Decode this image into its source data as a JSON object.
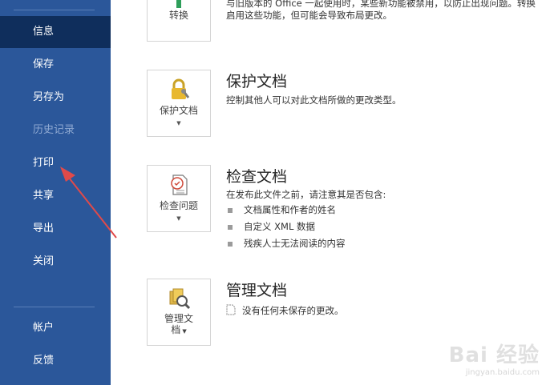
{
  "sidebar": {
    "items": [
      {
        "label": "信息",
        "state": "active"
      },
      {
        "label": "保存",
        "state": "normal"
      },
      {
        "label": "另存为",
        "state": "normal"
      },
      {
        "label": "历史记录",
        "state": "disabled"
      },
      {
        "label": "打印",
        "state": "normal"
      },
      {
        "label": "共享",
        "state": "normal"
      },
      {
        "label": "导出",
        "state": "normal"
      },
      {
        "label": "关闭",
        "state": "normal"
      }
    ],
    "bottom_items": [
      {
        "label": "帐户"
      },
      {
        "label": "反馈"
      }
    ]
  },
  "convert": {
    "button_label": "转换",
    "text_line1": "与旧版本的 Office 一起使用时，某些新功能被禁用，以防止出现问题。转换",
    "text_line2": "启用这些功能，但可能会导致布局更改。"
  },
  "protect": {
    "button_label": "保护文档",
    "title": "保护文档",
    "description": "控制其他人可以对此文档所做的更改类型。"
  },
  "inspect": {
    "button_label": "检查问题",
    "title": "检查文档",
    "description": "在发布此文件之前，请注意其是否包含:",
    "bullets": [
      "文档属性和作者的姓名",
      "自定义 XML 数据",
      "残疾人士无法阅读的内容"
    ]
  },
  "manage": {
    "button_label_line1": "管理文",
    "button_label_line2": "档",
    "title": "管理文档",
    "status": "没有任何未保存的更改。"
  },
  "watermark": {
    "brand": "Bai 经验",
    "url": "jingyan.baidu.com"
  },
  "colors": {
    "sidebar_bg": "#2b579a",
    "sidebar_active": "#0f2e5c",
    "annotation_arrow": "#e04a4a"
  }
}
